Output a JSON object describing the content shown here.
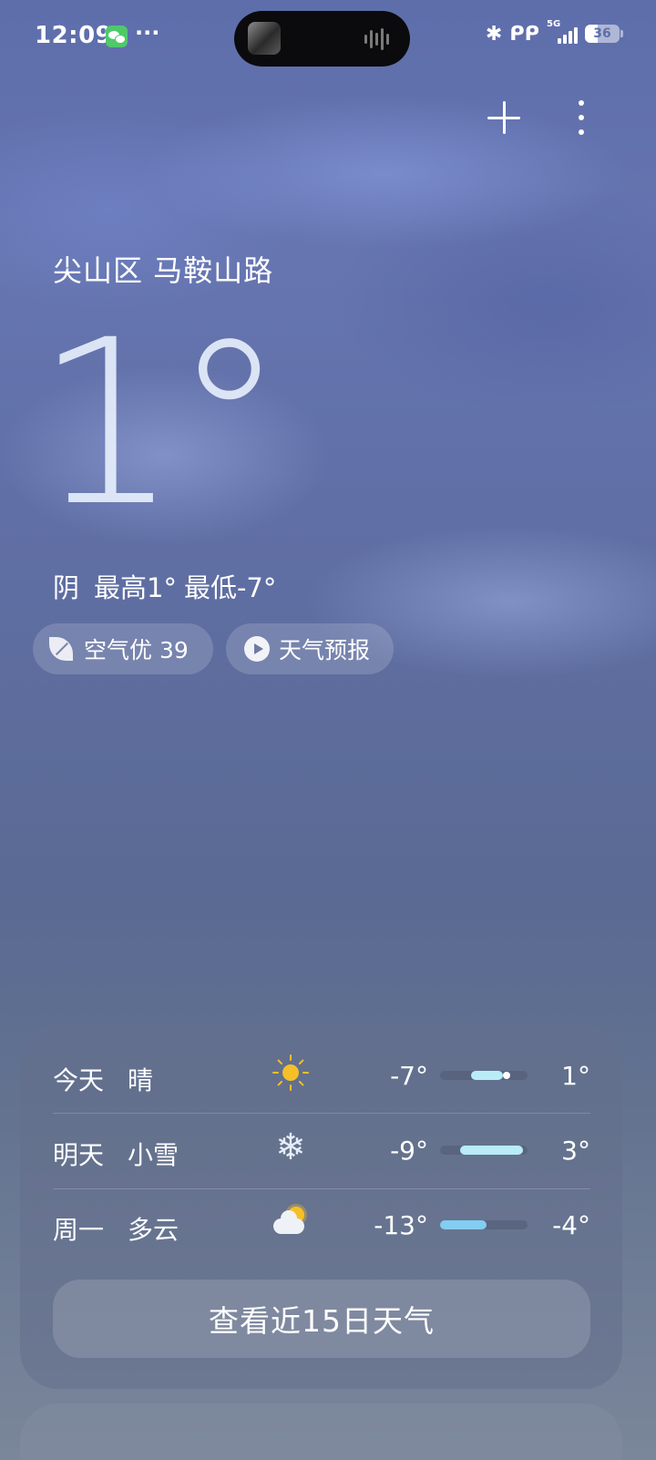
{
  "status_bar": {
    "time": "12:09",
    "notification_more": "···",
    "network": "5G",
    "battery": "36",
    "icons": [
      "wechat-icon",
      "bluetooth-icon",
      "earbuds-icon",
      "signal-icon",
      "battery-icon"
    ]
  },
  "header": {
    "add_icon": "plus-icon",
    "menu_icon": "more-vertical-icon"
  },
  "current": {
    "location": "尖山区 马鞍山路",
    "temperature": "1°",
    "condition": "阴",
    "high": "最高1°",
    "low": "最低-7°"
  },
  "chips": {
    "air_quality": "空气优 39",
    "forecast": "天气预报"
  },
  "forecast": {
    "days": [
      {
        "day": "今天",
        "condition": "晴",
        "icon": "sun-icon",
        "low": "-7°",
        "high": "1°",
        "range": {
          "start": 0.35,
          "end": 0.72,
          "current": 0.76
        },
        "color": "#b9ecf7"
      },
      {
        "day": "明天",
        "condition": "小雪",
        "icon": "snowflake-icon",
        "low": "-9°",
        "high": "3°",
        "range": {
          "start": 0.23,
          "end": 0.95
        },
        "color": "#b9ecf7"
      },
      {
        "day": "周一",
        "condition": "多云",
        "icon": "cloud-sun-icon",
        "low": "-13°",
        "high": "-4°",
        "range": {
          "start": 0.0,
          "end": 0.53
        },
        "color": "#83cdf0"
      }
    ],
    "more_button": "查看近15日天气"
  }
}
